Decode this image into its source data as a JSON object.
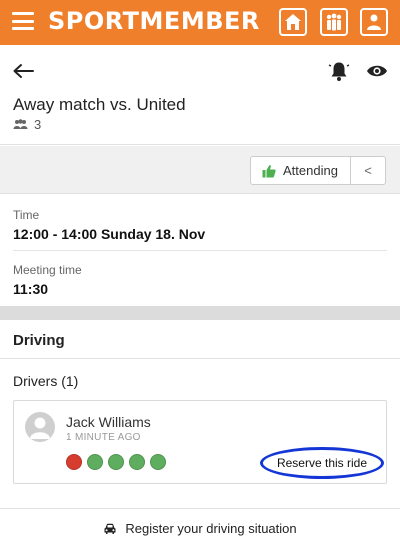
{
  "app": {
    "logo_text": "SPORTMEMBER",
    "brand_color": "#f07f2b"
  },
  "top_icons": [
    "home-icon",
    "team-icon",
    "profile-icon"
  ],
  "event": {
    "title": "Away match vs. United",
    "participant_count": "3"
  },
  "attendance": {
    "label": "Attending",
    "collapse_glyph": "<"
  },
  "time": {
    "label": "Time",
    "value": "12:00 - 14:00 Sunday 18. Nov"
  },
  "meeting": {
    "label": "Meeting time",
    "value": "11:30"
  },
  "driving": {
    "section_title": "Driving",
    "drivers_heading": "Drivers (1)",
    "drivers": [
      {
        "name": "Jack Williams",
        "time_ago": "1 MINUTE AGO",
        "seat_colors": [
          "#d63d2f",
          "#5fad5f",
          "#5fad5f",
          "#5fad5f",
          "#5fad5f"
        ],
        "reserve_label": "Reserve this ride"
      }
    ]
  },
  "footer": {
    "register_label": "Register your driving situation"
  }
}
